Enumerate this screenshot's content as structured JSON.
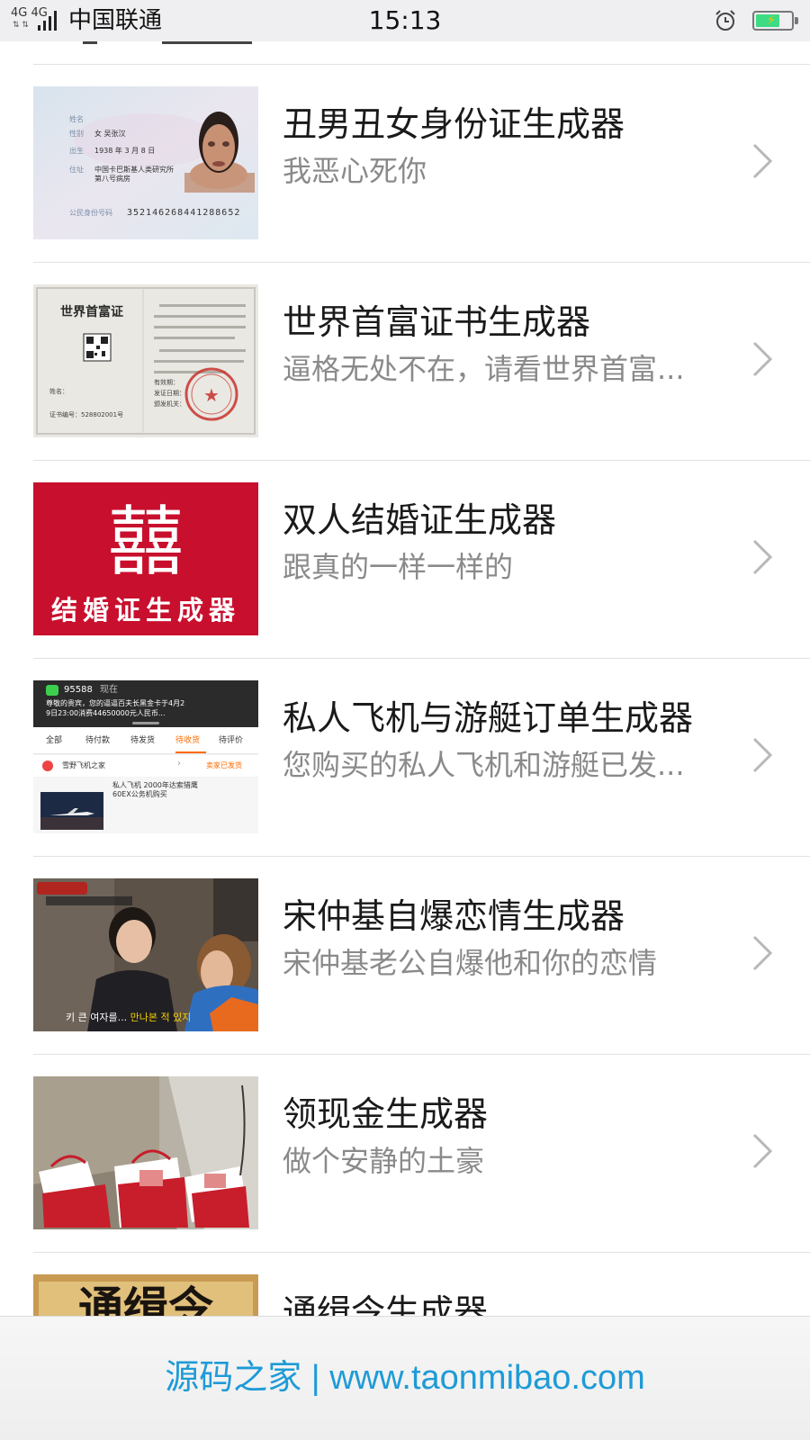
{
  "status_bar": {
    "network": "4G 4G",
    "carrier": "中国联通",
    "time": "15:13"
  },
  "items": [
    {
      "title": "丑男丑女身份证生成器",
      "subtitle": "我恶心死你"
    },
    {
      "title": "世界首富证书生成器",
      "subtitle": "逼格无处不在，请看世界首富..."
    },
    {
      "title": "双人结婚证生成器",
      "subtitle": "跟真的一样一样的"
    },
    {
      "title": "私人飞机与游艇订单生成器",
      "subtitle": "您购买的私人飞机和游艇已发..."
    },
    {
      "title": "宋仲基自爆恋情生成器",
      "subtitle": "宋仲基老公自爆他和你的恋情"
    },
    {
      "title": "领现金生成器",
      "subtitle": "做个安静的土豪"
    },
    {
      "title": "通缉令生成器",
      "subtitle": ""
    }
  ],
  "thumbs": {
    "id_card": {
      "name": "女 吴张汉",
      "birth": "1938 年 3 月 8 日",
      "address": "中国卡巴斯基人类研究所 第八号病房",
      "number": "352146268441288652",
      "labels": [
        "姓名",
        "性别",
        "出生",
        "住址",
        "公民身份号码"
      ]
    },
    "certificate": {
      "heading": "世界首富证",
      "serial": "证书编号：528802001号",
      "lines": [
        "姓名：",
        "有效期：",
        "发证日期：",
        "颁发机关："
      ]
    },
    "marriage": {
      "caption": "结婚证生成器",
      "emblem": "囍"
    },
    "order": {
      "sender": "95588",
      "sender_time": "现在",
      "sms": "尊敬的贵宾，您的逼逼百夫长黑金卡于4月2",
      "sms2": "9日23:00消费44650000元人民币...",
      "tabs": [
        "全部",
        "待付款",
        "待发货",
        "待收货",
        "待评价"
      ],
      "active_tab": "待收货",
      "shop": "雪野飞机之家",
      "status": "卖家已发货",
      "product": "私人飞机 2000年达索猎鹰",
      "product2": "60EX公务机购买"
    },
    "song": {
      "subtitle": "키 큰 여자를...",
      "highlight": "만나본 적 있지"
    },
    "wanted": {
      "heading": "通缉令"
    }
  },
  "banner": {
    "text": "源码之家 | www.taonmibao.com"
  },
  "colors": {
    "link_blue": "#1e9bd7",
    "wedding_red": "#c8102e",
    "order_accent": "#ff6a00",
    "battery_green": "#3ddc84"
  }
}
